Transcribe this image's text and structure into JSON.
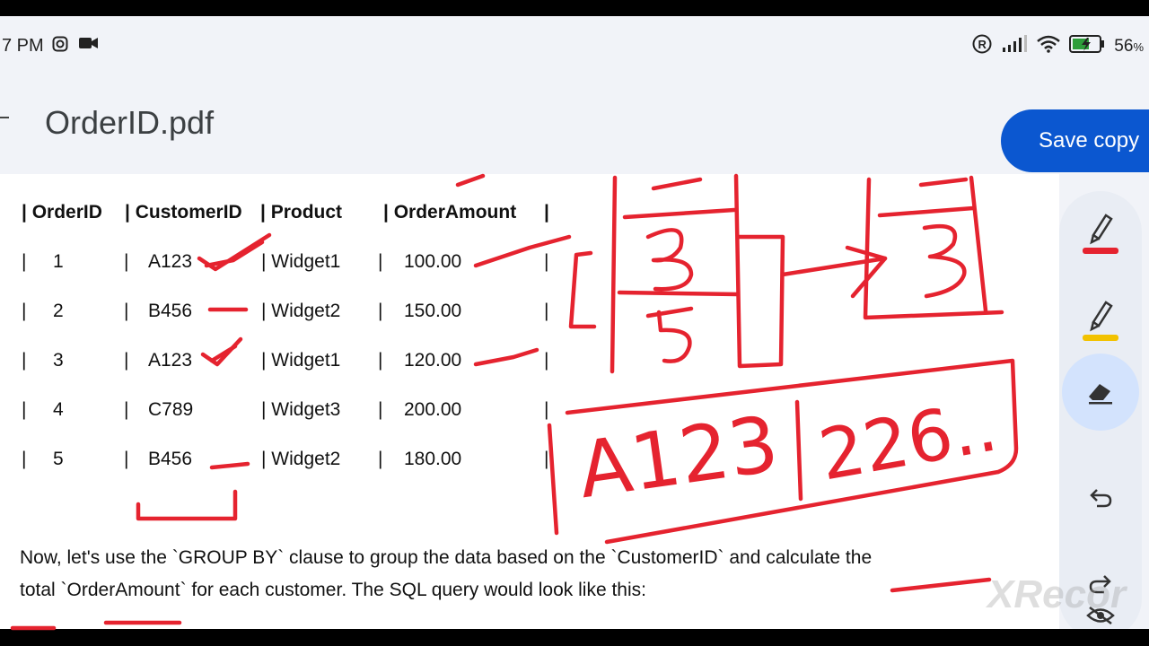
{
  "status": {
    "time": "7 PM",
    "battery": "56",
    "battery_unit": "%"
  },
  "header": {
    "title": "OrderID.pdf",
    "save_label": "Save copy"
  },
  "table": {
    "headers": [
      "| OrderID",
      "| CustomerID",
      "| Product",
      "| OrderAmount",
      "|"
    ],
    "rows": [
      [
        "|",
        "1",
        "|",
        "A123",
        "| Widget1",
        "|",
        "100.00",
        "|"
      ],
      [
        "|",
        "2",
        "|",
        "B456",
        "| Widget2",
        "|",
        "150.00",
        "|"
      ],
      [
        "|",
        "3",
        "|",
        "A123",
        "| Widget1",
        "|",
        "120.00",
        "|"
      ],
      [
        "|",
        "4",
        "|",
        "C789",
        "| Widget3",
        "|",
        "200.00",
        "|"
      ],
      [
        "|",
        "5",
        "|",
        "B456",
        "| Widget2",
        "|",
        "180.00",
        "|"
      ]
    ]
  },
  "paragraph": {
    "line1": "Now, let's use the `GROUP BY` clause to group the data based on the `CustomerID` and calculate the",
    "line2": "total `OrderAmount` for each customer. The SQL query would look like this:"
  },
  "annotation": {
    "customer": "A123",
    "amount": "226..",
    "top_left": "3",
    "top_left_under": "5",
    "top_right": "3"
  },
  "tools": [
    {
      "name": "pen-red-icon",
      "color": "#e5232f"
    },
    {
      "name": "highlighter-yellow-icon",
      "color": "#f2c200"
    },
    {
      "name": "eraser-icon"
    },
    {
      "name": "undo-icon"
    },
    {
      "name": "redo-icon"
    },
    {
      "name": "hide-icon"
    }
  ],
  "watermark": "XRecor",
  "colors": {
    "ink": "#e5232f",
    "accent": "#0b57d0"
  }
}
